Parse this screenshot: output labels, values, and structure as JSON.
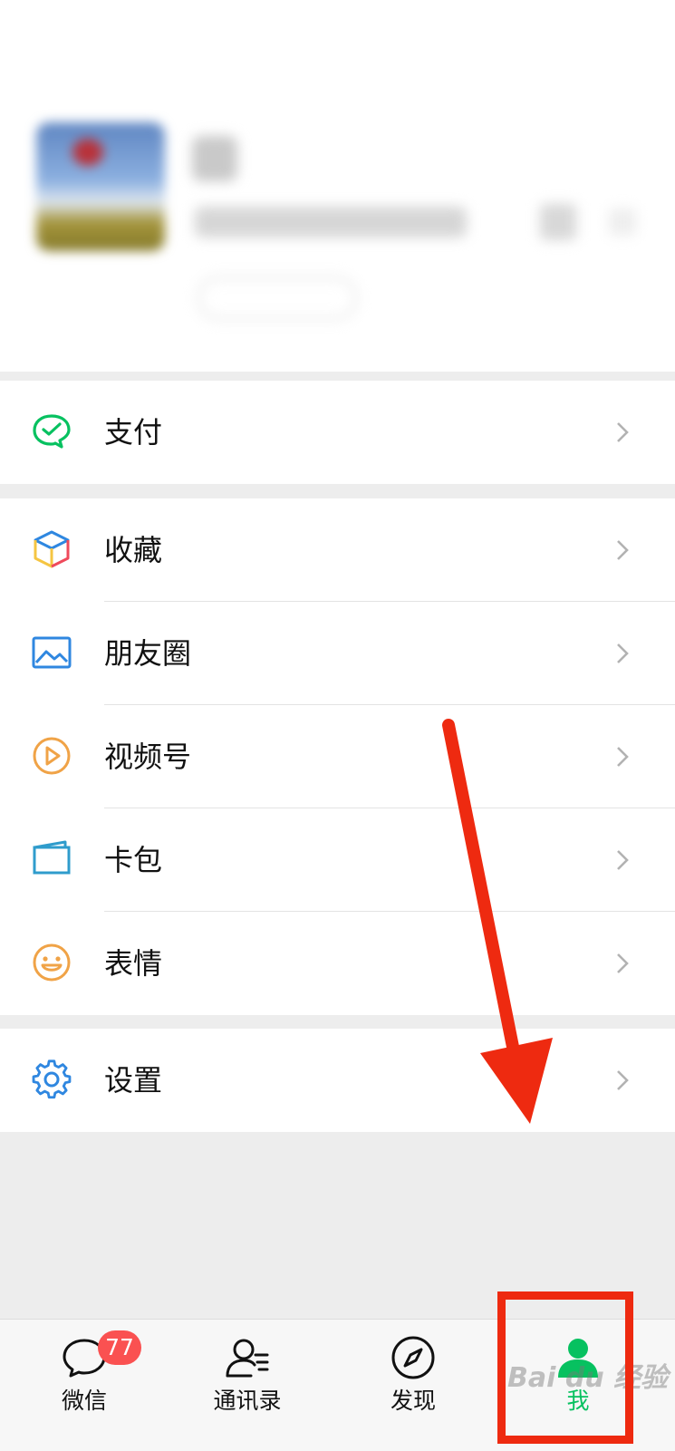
{
  "menu": {
    "pay": {
      "label": "支付"
    },
    "items": [
      {
        "label": "收藏"
      },
      {
        "label": "朋友圈"
      },
      {
        "label": "视频号"
      },
      {
        "label": "卡包"
      },
      {
        "label": "表情"
      }
    ],
    "settings": {
      "label": "设置"
    }
  },
  "tabbar": {
    "tabs": [
      {
        "label": "微信",
        "badge": "77"
      },
      {
        "label": "通讯录"
      },
      {
        "label": "发现"
      },
      {
        "label": "我",
        "active": true
      }
    ]
  },
  "watermark": "Bai du 经验",
  "colors": {
    "accent": "#07c160",
    "badge": "#fa5151",
    "annotation": "#ee2a10"
  }
}
